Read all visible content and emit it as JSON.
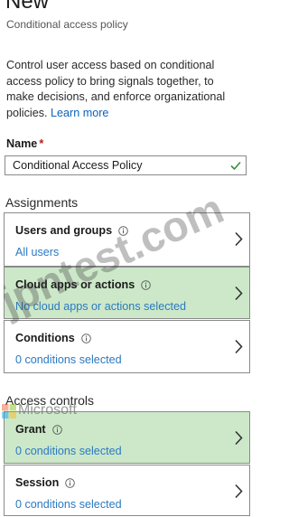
{
  "header": {
    "title": "New",
    "subtitle": "Conditional access policy"
  },
  "description": {
    "text": "Control user access based on conditional access policy to bring signals together, to make decisions, and enforce organizational policies.",
    "link_label": "Learn more"
  },
  "name_field": {
    "label": "Name",
    "required_marker": "*",
    "value": "Conditional Access Policy"
  },
  "assignments": {
    "heading": "Assignments",
    "items": [
      {
        "title": "Users and groups",
        "value": "All users"
      },
      {
        "title": "Cloud apps or actions",
        "value": "No cloud apps or actions selected"
      },
      {
        "title": "Conditions",
        "value": "0 conditions selected"
      }
    ]
  },
  "access_controls": {
    "heading": "Access controls",
    "items": [
      {
        "title": "Grant",
        "value": "0 conditions selected"
      },
      {
        "title": "Session",
        "value": "0 conditions selected"
      }
    ]
  },
  "watermark": {
    "text": "jpntest.com",
    "logo_text": "Microsoft"
  },
  "colors": {
    "link": "#0d62bc",
    "value_text": "#2b79c2",
    "highlight": "#cce8c9",
    "valid_check": "#3a8f3a",
    "required": "#b71c1c"
  },
  "icons": {
    "info": "info-icon",
    "chevron": "chevron-right-icon",
    "valid": "checkmark-icon"
  }
}
